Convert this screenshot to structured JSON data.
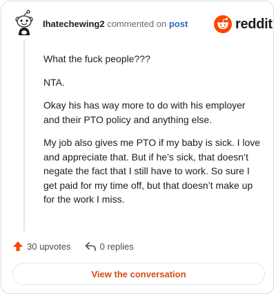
{
  "header": {
    "username": "Ihatechewing2",
    "action_text": "commented on",
    "post_link": "post",
    "brand_name": "reddit"
  },
  "comment": {
    "paragraphs": [
      "What the fuck people???",
      "NTA.",
      "Okay his has way more to do with his employer and their PTO policy and anything else.",
      "My job also gives me PTO if my baby is sick. I love and appreciate that. But if he’s sick, that doesn’t negate the fact that I still have to work. So sure I get paid for my time off, but that doesn’t make up for the work I miss."
    ]
  },
  "actions": {
    "upvotes": "30 upvotes",
    "replies": "0 replies",
    "upvote_icon": "upvote-arrow-icon",
    "reply_icon": "reply-arrow-icon"
  },
  "cta": {
    "label": "View the conversation"
  },
  "colors": {
    "brand": "#ff4500",
    "link": "#2a64c8",
    "cta": "#d84a12"
  }
}
